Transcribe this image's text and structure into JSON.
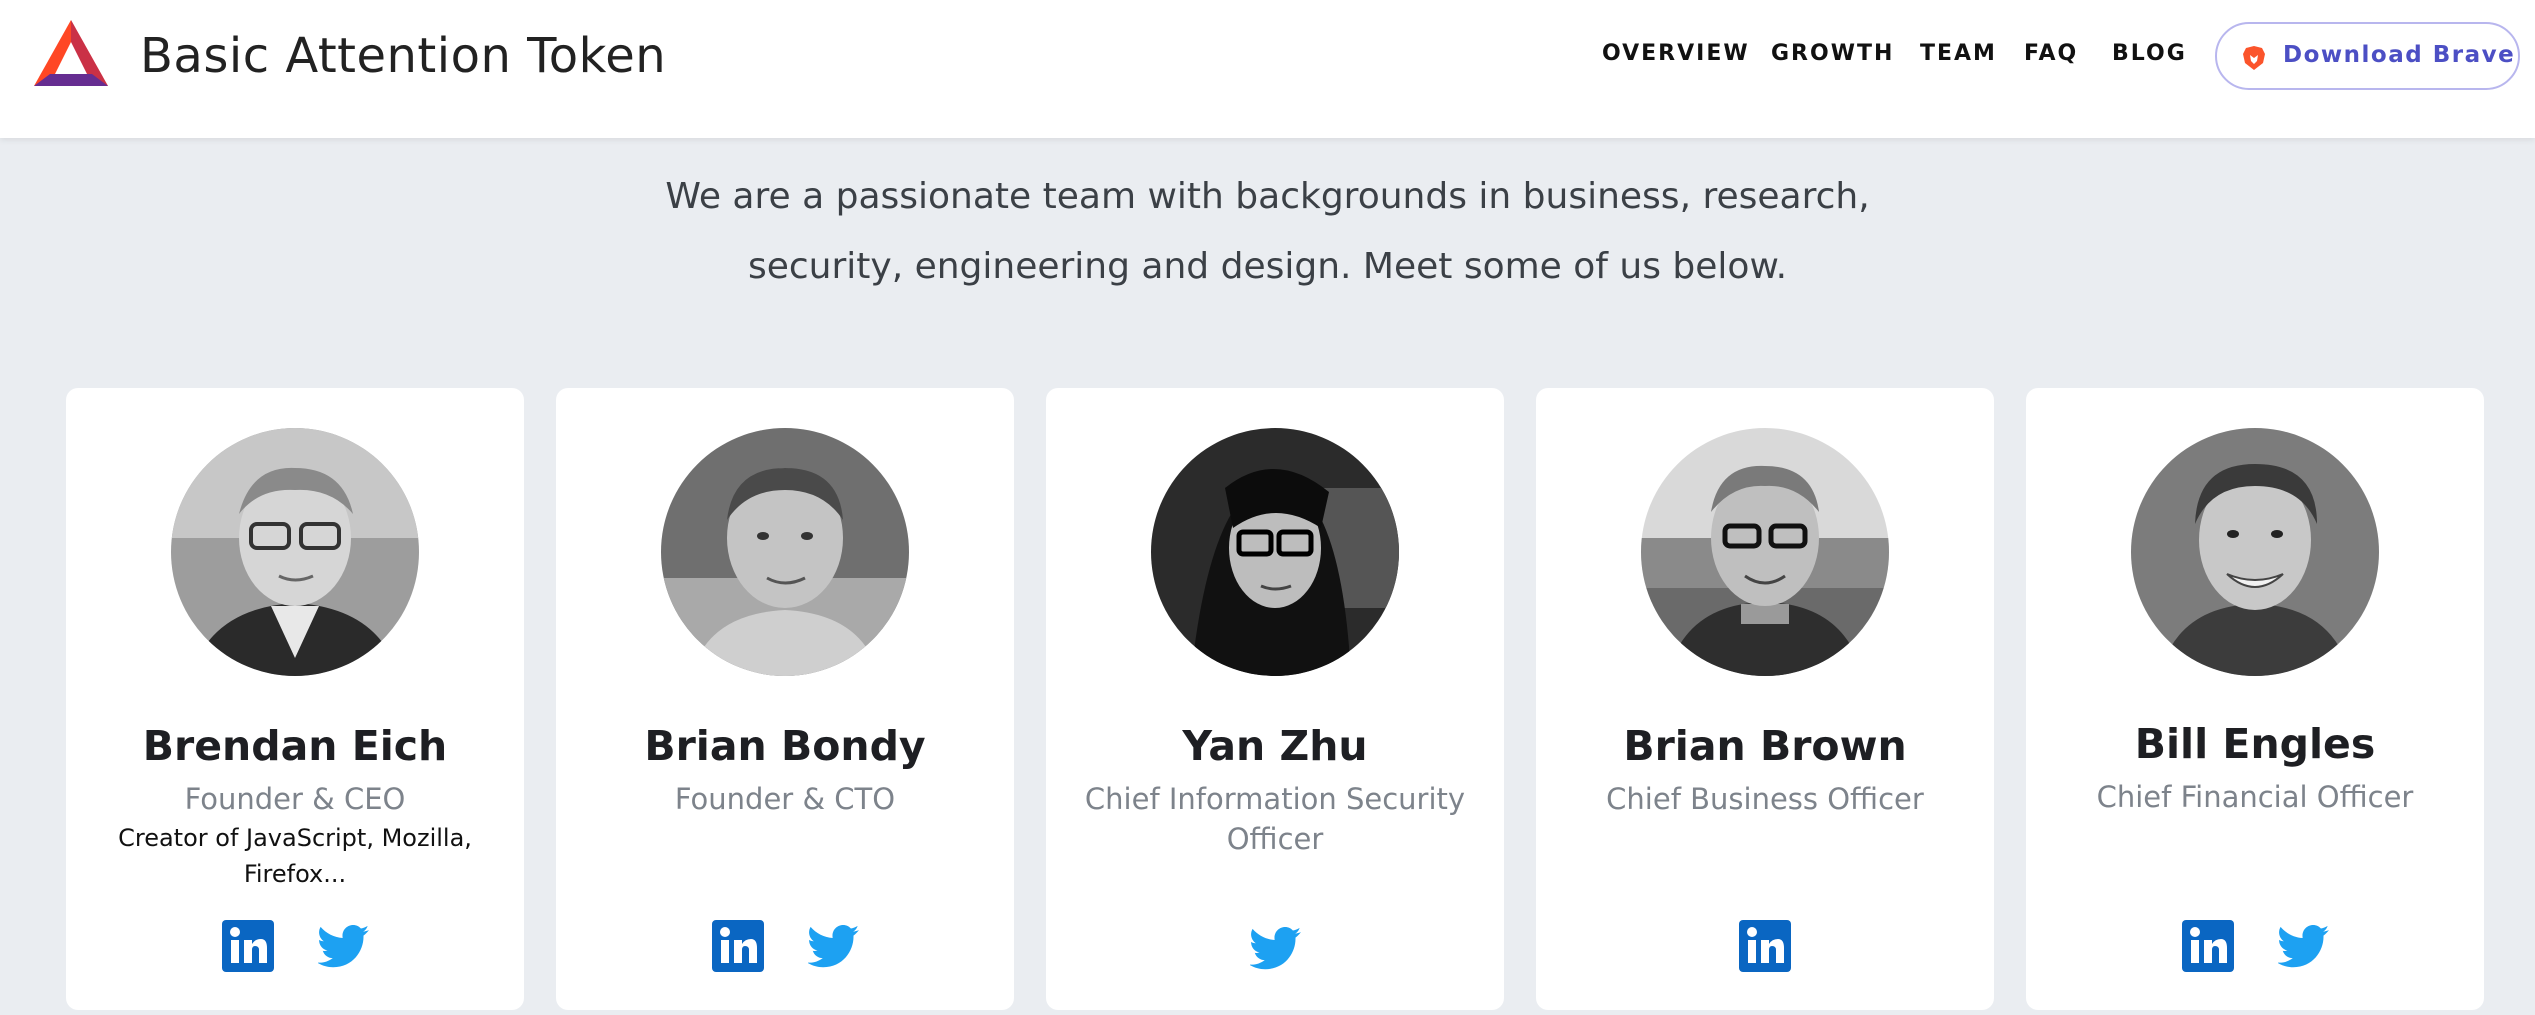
{
  "header": {
    "brand_title": "Basic Attention Token",
    "nav": [
      "OVERVIEW",
      "GROWTH",
      "TEAM",
      "FAQ",
      "BLOG"
    ],
    "download_label": "Download Brave"
  },
  "intro": {
    "line1": "We are a passionate team with backgrounds in business, research,",
    "line2": "security, engineering and design. Meet some of us below."
  },
  "team": [
    {
      "name": "Brendan Eich",
      "role": "Founder & CEO",
      "desc": "Creator of JavaScript, Mozilla, Firefox...",
      "links": [
        "linkedin",
        "twitter"
      ]
    },
    {
      "name": "Brian Bondy",
      "role": "Founder & CTO",
      "desc": "",
      "links": [
        "linkedin",
        "twitter"
      ]
    },
    {
      "name": "Yan Zhu",
      "role": "Chief Information Security Officer",
      "desc": "",
      "links": [
        "twitter"
      ]
    },
    {
      "name": "Brian Brown",
      "role": "Chief Business Officer",
      "desc": "",
      "links": [
        "linkedin"
      ]
    },
    {
      "name": "Bill Engles",
      "role": "Chief Financial Officer",
      "desc": "",
      "links": [
        "linkedin",
        "twitter"
      ]
    }
  ],
  "colors": {
    "page_bg": "#eaedf1",
    "brand_accent": "#4c4fc4",
    "linkedin_blue": "#0a66c2",
    "twitter_blue": "#1da1f2"
  }
}
